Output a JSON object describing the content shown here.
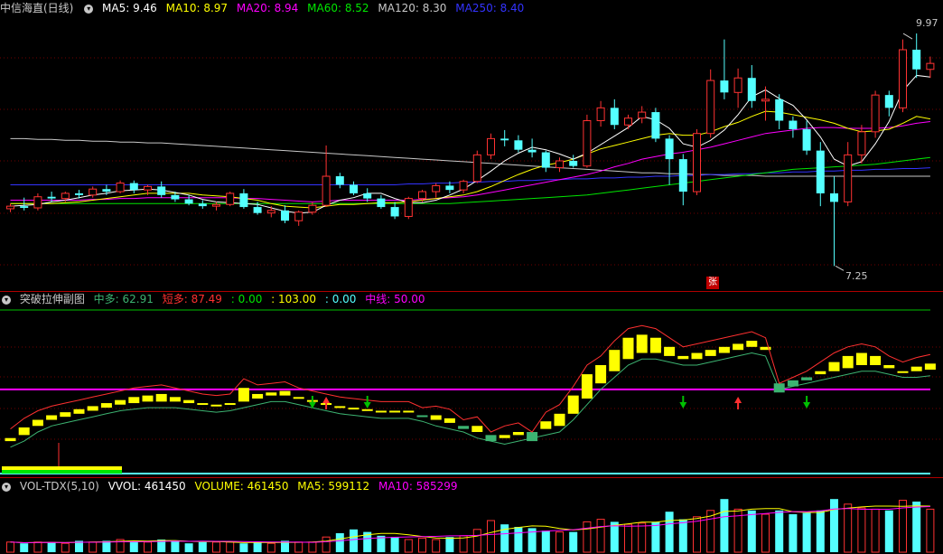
{
  "colors": {
    "bg": "#000000",
    "up": "#ff3232",
    "down": "#54ffff",
    "ma5": "#ffffff",
    "ma10": "#ffff00",
    "ma20": "#ff00ff",
    "ma60": "#00e600",
    "ma120": "#c8c8c8",
    "ma250": "#3333ff",
    "zhongduo": "#3cb371",
    "duanduo": "#ff3030",
    "zhongxian": "#ff00ff"
  },
  "main_panel": {
    "title": "中信海直(日线)",
    "collapse_icon": "chevron-down-icon",
    "ma5": "MA5: 9.46",
    "ma10": "MA10: 8.97",
    "ma20": "MA20: 8.94",
    "ma60": "MA60: 8.52",
    "ma120": "MA120: 8.30",
    "ma250": "MA250: 8.40",
    "high_label": "9.97",
    "low_label": "7.25",
    "zhang_badge": "张"
  },
  "sub_panel": {
    "title": "突破拉伸副图",
    "zhongduo": "中多: 62.91",
    "duanduo": "短多: 87.49",
    "v1": ": 0.00",
    "v2": ": 103.00",
    "v3": ": 0.00",
    "zhongxian": "中线: 50.00"
  },
  "vol_panel": {
    "title": "VOL-TDX(5,10)",
    "vvol": "VVOL: 461450",
    "volume": "VOLUME: 461450",
    "ma5": "MA5: 599112",
    "ma10": "MA10: 585299"
  },
  "chart_data": {
    "type": "candlestick",
    "title": "中信海直(日线)",
    "ohlc": [
      [
        7.92,
        7.98,
        7.88,
        7.95
      ],
      [
        7.95,
        8.05,
        7.9,
        7.93
      ],
      [
        7.93,
        8.1,
        7.9,
        8.06
      ],
      [
        8.06,
        8.12,
        8.0,
        8.04
      ],
      [
        8.04,
        8.12,
        8.0,
        8.1
      ],
      [
        8.1,
        8.14,
        8.04,
        8.08
      ],
      [
        8.08,
        8.18,
        8.05,
        8.15
      ],
      [
        8.15,
        8.2,
        8.08,
        8.12
      ],
      [
        8.12,
        8.25,
        8.1,
        8.22
      ],
      [
        8.22,
        8.25,
        8.1,
        8.14
      ],
      [
        8.14,
        8.2,
        8.08,
        8.18
      ],
      [
        8.18,
        8.24,
        8.05,
        8.08
      ],
      [
        8.08,
        8.12,
        8.0,
        8.03
      ],
      [
        8.03,
        8.08,
        7.96,
        7.98
      ],
      [
        7.98,
        8.02,
        7.92,
        7.95
      ],
      [
        7.95,
        8.0,
        7.9,
        7.97
      ],
      [
        7.97,
        8.12,
        7.95,
        8.1
      ],
      [
        8.1,
        8.15,
        7.92,
        7.94
      ],
      [
        7.94,
        8.0,
        7.85,
        7.87
      ],
      [
        7.87,
        7.95,
        7.82,
        7.9
      ],
      [
        7.9,
        7.96,
        7.75,
        7.78
      ],
      [
        7.78,
        7.9,
        7.72,
        7.88
      ],
      [
        7.88,
        8.0,
        7.85,
        7.96
      ],
      [
        7.96,
        8.66,
        7.94,
        8.3
      ],
      [
        8.3,
        8.34,
        8.16,
        8.2
      ],
      [
        8.2,
        8.24,
        8.08,
        8.1
      ],
      [
        8.1,
        8.16,
        8.0,
        8.04
      ],
      [
        8.04,
        8.08,
        7.92,
        7.94
      ],
      [
        7.94,
        8.0,
        7.8,
        7.83
      ],
      [
        7.83,
        8.06,
        7.8,
        8.04
      ],
      [
        8.04,
        8.14,
        8.0,
        8.12
      ],
      [
        8.12,
        8.22,
        8.05,
        8.19
      ],
      [
        8.19,
        8.24,
        8.1,
        8.14
      ],
      [
        8.14,
        8.26,
        8.1,
        8.24
      ],
      [
        8.24,
        8.6,
        8.22,
        8.55
      ],
      [
        8.55,
        8.8,
        8.5,
        8.74
      ],
      [
        8.74,
        8.84,
        8.65,
        8.72
      ],
      [
        8.72,
        8.78,
        8.58,
        8.61
      ],
      [
        8.61,
        8.74,
        8.52,
        8.58
      ],
      [
        8.58,
        8.6,
        8.35,
        8.4
      ],
      [
        8.4,
        8.52,
        8.35,
        8.48
      ],
      [
        8.48,
        8.55,
        8.4,
        8.42
      ],
      [
        8.42,
        9.02,
        8.4,
        8.95
      ],
      [
        8.95,
        9.18,
        8.88,
        9.1
      ],
      [
        9.1,
        9.2,
        8.85,
        8.9
      ],
      [
        8.9,
        9.02,
        8.85,
        8.98
      ],
      [
        8.98,
        9.12,
        8.92,
        9.05
      ],
      [
        9.05,
        9.1,
        8.7,
        8.74
      ],
      [
        8.74,
        8.78,
        8.2,
        8.5
      ],
      [
        8.5,
        8.56,
        7.96,
        8.12
      ],
      [
        8.12,
        8.85,
        8.08,
        8.8
      ],
      [
        8.8,
        9.55,
        8.75,
        9.42
      ],
      [
        9.42,
        9.9,
        9.2,
        9.28
      ],
      [
        9.28,
        9.56,
        9.1,
        9.45
      ],
      [
        9.45,
        9.6,
        9.1,
        9.18
      ],
      [
        9.18,
        9.35,
        8.95,
        9.2
      ],
      [
        9.2,
        9.26,
        8.85,
        8.95
      ],
      [
        8.95,
        9.0,
        8.75,
        8.85
      ],
      [
        8.85,
        8.95,
        8.55,
        8.6
      ],
      [
        8.6,
        8.7,
        7.95,
        8.1
      ],
      [
        8.1,
        8.3,
        7.25,
        8.0
      ],
      [
        8.0,
        8.7,
        7.95,
        8.55
      ],
      [
        8.55,
        8.9,
        8.45,
        8.82
      ],
      [
        8.82,
        9.3,
        8.75,
        9.25
      ],
      [
        9.25,
        9.3,
        9.0,
        9.1
      ],
      [
        9.1,
        9.9,
        9.05,
        9.78
      ],
      [
        9.78,
        9.97,
        9.45,
        9.55
      ],
      [
        9.55,
        9.7,
        9.45,
        9.62
      ]
    ],
    "ma_lines": {
      "ma5": [
        7.95,
        7.96,
        7.97,
        8.0,
        8.02,
        8.05,
        8.08,
        8.1,
        8.13,
        8.14,
        8.15,
        8.14,
        8.11,
        8.08,
        8.03,
        8.0,
        7.99,
        7.98,
        7.97,
        7.93,
        7.89,
        7.87,
        7.88,
        7.96,
        8.02,
        8.05,
        8.1,
        8.1,
        8.04,
        7.99,
        7.99,
        8.02,
        8.08,
        8.15,
        8.25,
        8.36,
        8.48,
        8.57,
        8.64,
        8.61,
        8.56,
        8.5,
        8.57,
        8.67,
        8.77,
        8.87,
        9.0,
        8.96,
        8.86,
        8.68,
        8.64,
        8.72,
        8.84,
        9.02,
        9.23,
        9.31,
        9.21,
        9.13,
        8.96,
        8.76,
        8.5,
        8.42,
        8.47,
        8.68,
        8.94,
        9.3,
        9.48,
        9.46
      ],
      "ma10": [
        7.98,
        7.98,
        7.98,
        7.98,
        7.99,
        8.0,
        8.02,
        8.04,
        8.06,
        8.08,
        8.1,
        8.1,
        8.1,
        8.1,
        8.08,
        8.07,
        8.06,
        8.04,
        8.02,
        7.98,
        7.95,
        7.94,
        7.93,
        7.95,
        7.97,
        7.97,
        7.98,
        7.99,
        7.99,
        8.0,
        8.02,
        8.04,
        8.06,
        8.08,
        8.12,
        8.18,
        8.25,
        8.32,
        8.38,
        8.43,
        8.46,
        8.5,
        8.56,
        8.62,
        8.66,
        8.7,
        8.74,
        8.78,
        8.8,
        8.78,
        8.78,
        8.82,
        8.88,
        8.93,
        9.0,
        9.06,
        9.05,
        9.02,
        8.99,
        8.96,
        8.92,
        8.86,
        8.82,
        8.83,
        8.85,
        8.92,
        9.0,
        8.97
      ],
      "ma20": [
        8.02,
        8.02,
        8.02,
        8.02,
        8.02,
        8.02,
        8.03,
        8.03,
        8.04,
        8.04,
        8.05,
        8.05,
        8.05,
        8.05,
        8.05,
        8.05,
        8.05,
        8.04,
        8.04,
        8.03,
        8.02,
        8.01,
        8.0,
        8.01,
        8.02,
        8.02,
        8.02,
        8.02,
        8.02,
        8.02,
        8.03,
        8.04,
        8.05,
        8.06,
        8.08,
        8.11,
        8.14,
        8.17,
        8.2,
        8.23,
        8.26,
        8.29,
        8.32,
        8.36,
        8.41,
        8.45,
        8.5,
        8.53,
        8.56,
        8.58,
        8.61,
        8.64,
        8.68,
        8.72,
        8.76,
        8.8,
        8.82,
        8.84,
        8.86,
        8.87,
        8.87,
        8.86,
        8.86,
        8.86,
        8.87,
        8.89,
        8.92,
        8.94
      ],
      "ma60": [
        7.98,
        7.98,
        7.98,
        7.98,
        7.98,
        7.98,
        7.98,
        7.98,
        7.98,
        7.98,
        7.98,
        7.98,
        7.98,
        7.98,
        7.98,
        7.98,
        7.98,
        7.98,
        7.98,
        7.98,
        7.98,
        7.98,
        7.98,
        7.98,
        7.98,
        7.98,
        7.98,
        7.98,
        7.98,
        7.98,
        7.98,
        7.98,
        7.98,
        7.99,
        8.0,
        8.01,
        8.02,
        8.03,
        8.04,
        8.05,
        8.06,
        8.07,
        8.08,
        8.1,
        8.12,
        8.14,
        8.16,
        8.18,
        8.2,
        8.22,
        8.24,
        8.26,
        8.28,
        8.3,
        8.32,
        8.34,
        8.36,
        8.38,
        8.39,
        8.4,
        8.41,
        8.42,
        8.43,
        8.44,
        8.46,
        8.48,
        8.5,
        8.52
      ],
      "ma120": [
        8.74,
        8.74,
        8.73,
        8.73,
        8.72,
        8.72,
        8.71,
        8.71,
        8.7,
        8.7,
        8.69,
        8.69,
        8.68,
        8.67,
        8.66,
        8.65,
        8.64,
        8.63,
        8.62,
        8.61,
        8.6,
        8.59,
        8.58,
        8.57,
        8.56,
        8.55,
        8.54,
        8.53,
        8.52,
        8.51,
        8.5,
        8.49,
        8.48,
        8.47,
        8.46,
        8.45,
        8.44,
        8.43,
        8.42,
        8.41,
        8.4,
        8.39,
        8.38,
        8.37,
        8.36,
        8.35,
        8.34,
        8.34,
        8.33,
        8.33,
        8.32,
        8.32,
        8.31,
        8.31,
        8.31,
        8.3,
        8.3,
        8.3,
        8.3,
        8.3,
        8.3,
        8.3,
        8.3,
        8.3,
        8.3,
        8.3,
        8.3,
        8.3
      ],
      "ma250": [
        8.2,
        8.2,
        8.2,
        8.2,
        8.2,
        8.2,
        8.2,
        8.2,
        8.2,
        8.2,
        8.2,
        8.2,
        8.2,
        8.2,
        8.2,
        8.2,
        8.2,
        8.2,
        8.2,
        8.2,
        8.2,
        8.2,
        8.2,
        8.2,
        8.2,
        8.2,
        8.2,
        8.2,
        8.2,
        8.21,
        8.21,
        8.22,
        8.22,
        8.23,
        8.23,
        8.24,
        8.24,
        8.25,
        8.25,
        8.26,
        8.26,
        8.27,
        8.27,
        8.28,
        8.28,
        8.29,
        8.29,
        8.3,
        8.3,
        8.31,
        8.31,
        8.32,
        8.32,
        8.33,
        8.33,
        8.34,
        8.34,
        8.35,
        8.35,
        8.36,
        8.36,
        8.37,
        8.37,
        8.38,
        8.38,
        8.39,
        8.39,
        8.4
      ]
    },
    "y_range": [
      7.0,
      10.15
    ],
    "sub_bars": [
      [
        16,
        18
      ],
      [
        20,
        25
      ],
      [
        26,
        30
      ],
      [
        30,
        33
      ],
      [
        32,
        35
      ],
      [
        34,
        37
      ],
      [
        36,
        39
      ],
      [
        38,
        41
      ],
      [
        40,
        43
      ],
      [
        41,
        45
      ],
      [
        42,
        46
      ],
      [
        42,
        47
      ],
      [
        42,
        45
      ],
      [
        41,
        43
      ],
      [
        40,
        41
      ],
      [
        39,
        40
      ],
      [
        40,
        41
      ],
      [
        42,
        51
      ],
      [
        44,
        47
      ],
      [
        46,
        48
      ],
      [
        46,
        49
      ],
      [
        44,
        45
      ],
      [
        42,
        43
      ],
      [
        40,
        41
      ],
      [
        38,
        39
      ],
      [
        37,
        38
      ],
      [
        36,
        37
      ],
      [
        35,
        36
      ],
      [
        35,
        36
      ],
      [
        35,
        36
      ],
      [
        33,
        32
      ],
      [
        30,
        33
      ],
      [
        28,
        31
      ],
      [
        26,
        24
      ],
      [
        22,
        26
      ],
      [
        20,
        16
      ],
      [
        18,
        20
      ],
      [
        20,
        22
      ],
      [
        22,
        16
      ],
      [
        24,
        29
      ],
      [
        26,
        34
      ],
      [
        34,
        46
      ],
      [
        44,
        60
      ],
      [
        54,
        66
      ],
      [
        62,
        76
      ],
      [
        70,
        84
      ],
      [
        74,
        86
      ],
      [
        74,
        84
      ],
      [
        72,
        78
      ],
      [
        70,
        72
      ],
      [
        70,
        74
      ],
      [
        72,
        76
      ],
      [
        74,
        78
      ],
      [
        76,
        80
      ],
      [
        78,
        82
      ],
      [
        76,
        78
      ],
      [
        54,
        48
      ],
      [
        56,
        52
      ],
      [
        58,
        56
      ],
      [
        60,
        62
      ],
      [
        62,
        68
      ],
      [
        64,
        72
      ],
      [
        66,
        74
      ],
      [
        66,
        72
      ],
      [
        64,
        66
      ],
      [
        62,
        62
      ],
      [
        62,
        65
      ],
      [
        63,
        67
      ]
    ],
    "sub_ref_line": 50,
    "volumes": [
      0.8,
      0.7,
      0.8,
      0.8,
      0.7,
      0.9,
      0.8,
      0.9,
      1.0,
      0.9,
      0.8,
      1.0,
      0.9,
      0.7,
      0.8,
      0.8,
      0.8,
      0.7,
      0.8,
      0.7,
      0.9,
      0.8,
      0.8,
      1.2,
      1.5,
      1.8,
      1.6,
      1.3,
      1.2,
      1.0,
      1.1,
      1.0,
      1.2,
      1.3,
      1.8,
      2.5,
      2.2,
      2.0,
      1.9,
      1.7,
      1.6,
      1.6,
      2.4,
      2.6,
      2.4,
      2.2,
      2.3,
      2.4,
      3.2,
      2.6,
      2.8,
      3.3,
      4.2,
      3.4,
      3.3,
      3.0,
      3.3,
      3.0,
      3.1,
      3.3,
      4.2,
      3.8,
      3.5,
      3.4,
      3.3,
      4.1,
      4.0,
      3.4
    ]
  }
}
